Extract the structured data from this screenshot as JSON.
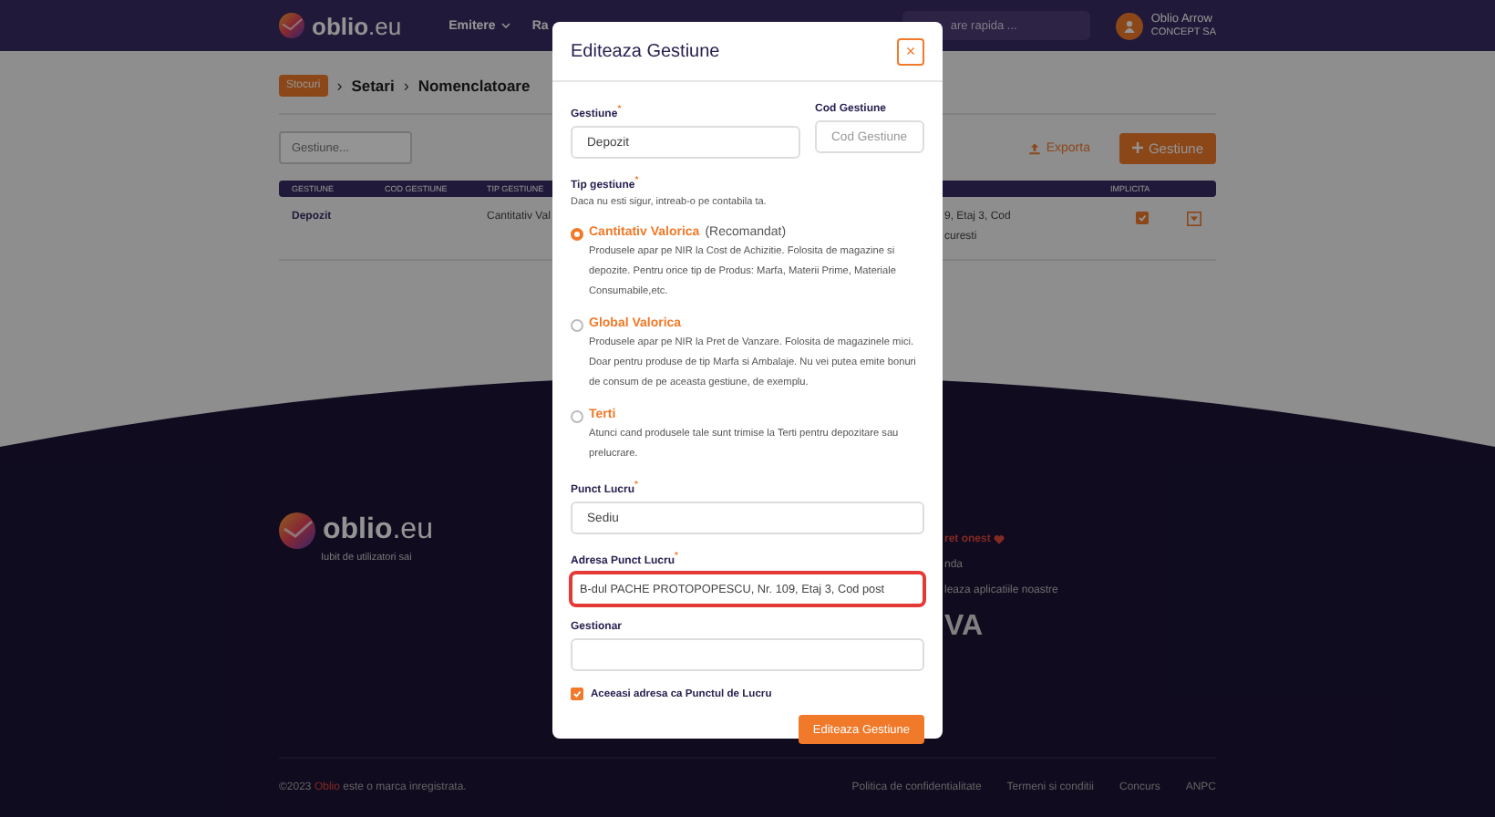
{
  "header": {
    "logo": {
      "name": "oblio",
      "domain": ".eu"
    },
    "nav": [
      {
        "label": "Emitere",
        "caret": true
      },
      {
        "label": "Ra",
        "caret": false
      }
    ],
    "search": {
      "placeholder": "are rapida ..."
    },
    "user": {
      "name": "Oblio Arrow",
      "company": "CONCEPT SA"
    }
  },
  "breadcrumb": {
    "separator": "›",
    "items": [
      {
        "label": "Stocuri",
        "kind": "badge"
      },
      {
        "label": "Setari",
        "kind": "text"
      },
      {
        "label": "Nomenclatoare",
        "kind": "text"
      }
    ]
  },
  "toolbar": {
    "filter_placeholder": "Gestiune...",
    "export": "Exporta",
    "add": "Gestiune"
  },
  "table": {
    "columns": [
      "GESTIUNE",
      "COD GESTIUNE",
      "TIP GESTIUNE",
      "",
      "IMPLICITA"
    ],
    "rows": [
      {
        "gestiune": "Depozit",
        "tip": "Cantitativ Val",
        "column_4": [
          "9, Etaj 3, Cod",
          "curesti"
        ],
        "implicit": true
      }
    ]
  },
  "footer": {
    "logo": {
      "name": "oblio",
      "domain": ".eu"
    },
    "tagline": "Iubit de utilizatori sai",
    "column_2": [
      {
        "text": "ret onest",
        "kind": "highlight"
      },
      {
        "text": "nda",
        "kind": "plain"
      },
      {
        "text": "leaza aplicatiile noastre",
        "kind": "plain"
      },
      {
        "text": "VA",
        "kind": "logo"
      }
    ],
    "copyright": {
      "prefix": "©2023",
      "brand": "Oblio",
      "suffix": "este o marca inregistrata."
    },
    "links": [
      "Politica de confidentialitate",
      "Termeni si conditii",
      "Concurs",
      "ANPC"
    ]
  },
  "modal": {
    "title": "Editeaza Gestiune",
    "close": "×",
    "gestiune": {
      "label": "Gestiune",
      "mark": "*",
      "value": "Depozit"
    },
    "cod": {
      "label": "Cod Gestiune",
      "placeholder": "Cod Gestiune"
    },
    "type": {
      "label": "Tip gestiune",
      "mark": "*",
      "hint": "Daca nu esti sigur, intreab-o pe contabila ta.",
      "options": [
        {
          "title": "Cantitativ Valorica",
          "note": "(Recomandat)",
          "description": "Produsele apar pe NIR la Cost de Achizitie. Folosita de magazine si depozite. Pentru orice tip de Produs: Marfa, Materii Prime, Materiale Consumabile,etc.",
          "selected": true
        },
        {
          "title": "Global Valorica",
          "description": "Produsele apar pe NIR la Pret de Vanzare. Folosita de magazinele mici. Doar pentru produse de tip Marfa si Ambalaje. Nu vei putea emite bonuri de consum de pe aceasta gestiune, de exemplu.",
          "selected": false
        },
        {
          "title": "Terti",
          "description": "Atunci cand produsele tale sunt trimise la Terti pentru depozitare sau prelucrare.",
          "selected": false
        }
      ]
    },
    "punct_lucru": {
      "label": "Punct Lucru",
      "mark": "*",
      "value": "Sediu"
    },
    "address": {
      "label": "Adresa Punct Lucru",
      "mark": "*",
      "value": "B-dul PACHE PROTOPOPESCU, Nr. 109, Etaj 3, Cod post",
      "invalid": true
    },
    "gestionar": {
      "label": "Gestionar"
    },
    "same_address": {
      "label": "Aceeasi adresa ca Punctul de Lucru",
      "checked": true
    },
    "submit": "Editeaza Gestiune"
  }
}
